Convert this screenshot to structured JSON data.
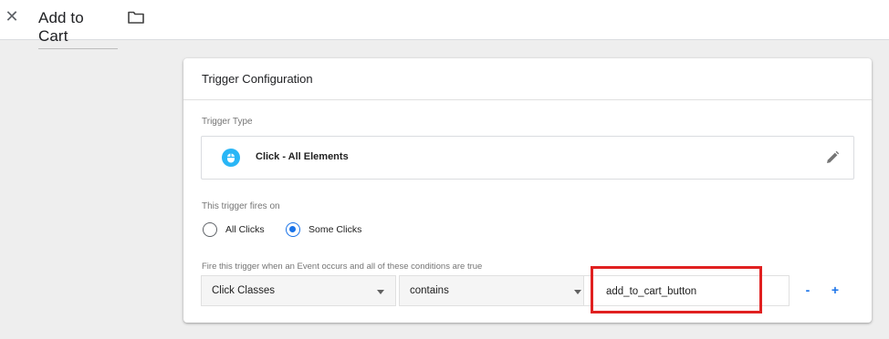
{
  "header": {
    "close_glyph": "✕",
    "title": "Add to Cart"
  },
  "card": {
    "title": "Trigger Configuration",
    "trigger_type_label": "Trigger Type",
    "trigger_type_value": "Click - All Elements",
    "fires_on_label": "This trigger fires on",
    "radio_all": "All Clicks",
    "radio_some": "Some Clicks",
    "selected_radio": "Some Clicks",
    "conditions_label": "Fire this trigger when an Event occurs and all of these conditions are true",
    "condition": {
      "variable": "Click Classes",
      "operator": "contains",
      "value": "add_to_cart_button"
    },
    "remove_label": "-",
    "add_label": "+"
  },
  "colors": {
    "accent": "#1a73e8",
    "trigger_icon": "#29b6f6",
    "highlight_box": "#e02020"
  }
}
